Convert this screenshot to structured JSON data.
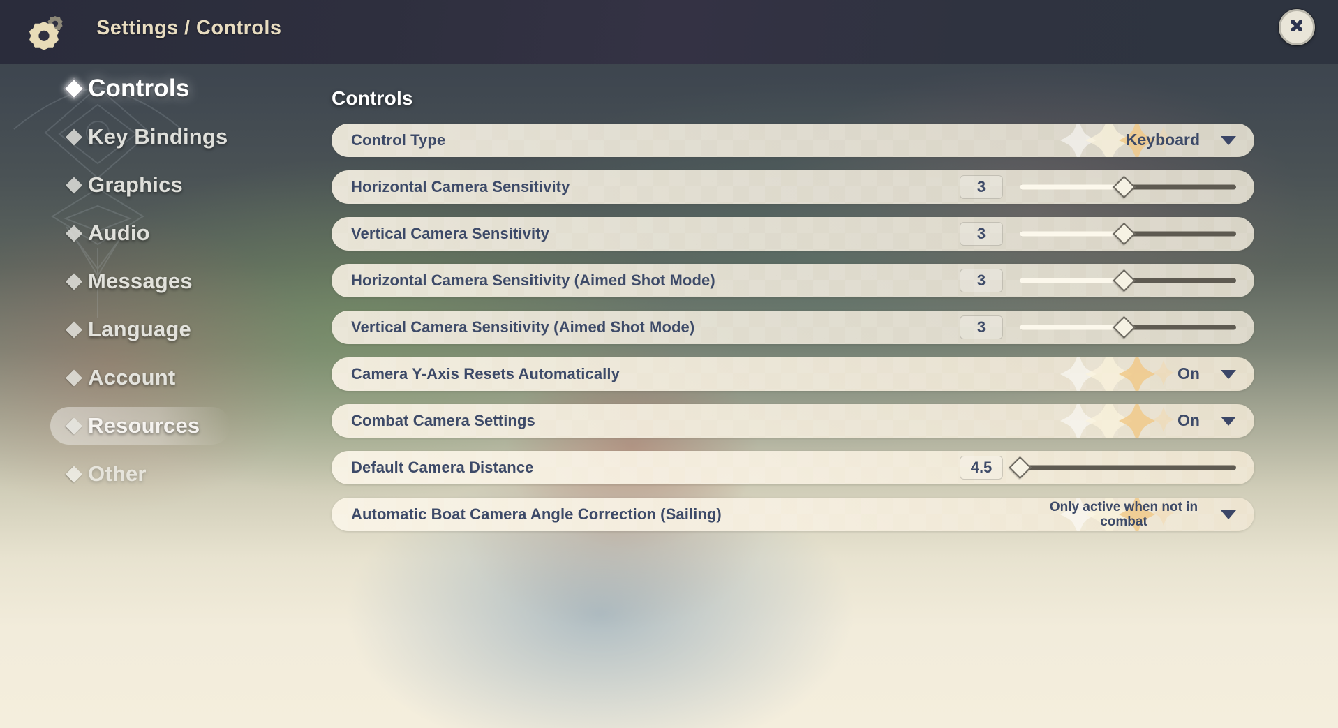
{
  "header": {
    "breadcrumb": "Settings / Controls",
    "gear_icon": "gear-icon",
    "close_icon": "close-icon",
    "bg_color": "#2e3040"
  },
  "sidebar": {
    "items": [
      {
        "label": "Controls",
        "state": "active"
      },
      {
        "label": "Key Bindings",
        "state": "normal"
      },
      {
        "label": "Graphics",
        "state": "normal"
      },
      {
        "label": "Audio",
        "state": "normal"
      },
      {
        "label": "Messages",
        "state": "normal"
      },
      {
        "label": "Language",
        "state": "normal"
      },
      {
        "label": "Account",
        "state": "normal"
      },
      {
        "label": "Resources",
        "state": "hovered"
      },
      {
        "label": "Other",
        "state": "faded"
      }
    ]
  },
  "main": {
    "section_title": "Controls",
    "rows": [
      {
        "label": "Control Type",
        "kind": "dropdown",
        "value": "Keyboard",
        "sparkles": true,
        "tint": ""
      },
      {
        "label": "Horizontal Camera Sensitivity",
        "kind": "slider",
        "value": "3",
        "percent": 48,
        "sparkles": false,
        "tint": ""
      },
      {
        "label": "Vertical Camera Sensitivity",
        "kind": "slider",
        "value": "3",
        "percent": 48,
        "sparkles": false,
        "tint": ""
      },
      {
        "label": "Horizontal Camera Sensitivity (Aimed Shot Mode)",
        "kind": "slider",
        "value": "3",
        "percent": 48,
        "sparkles": false,
        "tint": ""
      },
      {
        "label": "Vertical Camera Sensitivity (Aimed Shot Mode)",
        "kind": "slider",
        "value": "3",
        "percent": 48,
        "sparkles": false,
        "tint": ""
      },
      {
        "label": "Camera Y-Axis Resets Automatically",
        "kind": "dropdown",
        "value": "On",
        "sparkles": true,
        "tint": "warm"
      },
      {
        "label": "Combat Camera Settings",
        "kind": "dropdown",
        "value": "On",
        "sparkles": true,
        "tint": "warm"
      },
      {
        "label": "Default Camera Distance",
        "kind": "slider",
        "value": "4.5",
        "percent": 0,
        "sparkles": false,
        "tint": "warmer"
      },
      {
        "label": "Automatic Boat Camera Angle Correction (Sailing)",
        "kind": "dropdown",
        "value": "Only active when not in combat",
        "value_wrap": true,
        "sparkles": true,
        "tint": "warmer"
      }
    ]
  },
  "colors": {
    "label_text": "#3d4a68",
    "row_paper": "#ede8da",
    "slider_track": "#5e5a51",
    "slider_fill": "#fcf8ec",
    "accent_gold": "#e8dcc0",
    "caret": "#3b4667"
  }
}
